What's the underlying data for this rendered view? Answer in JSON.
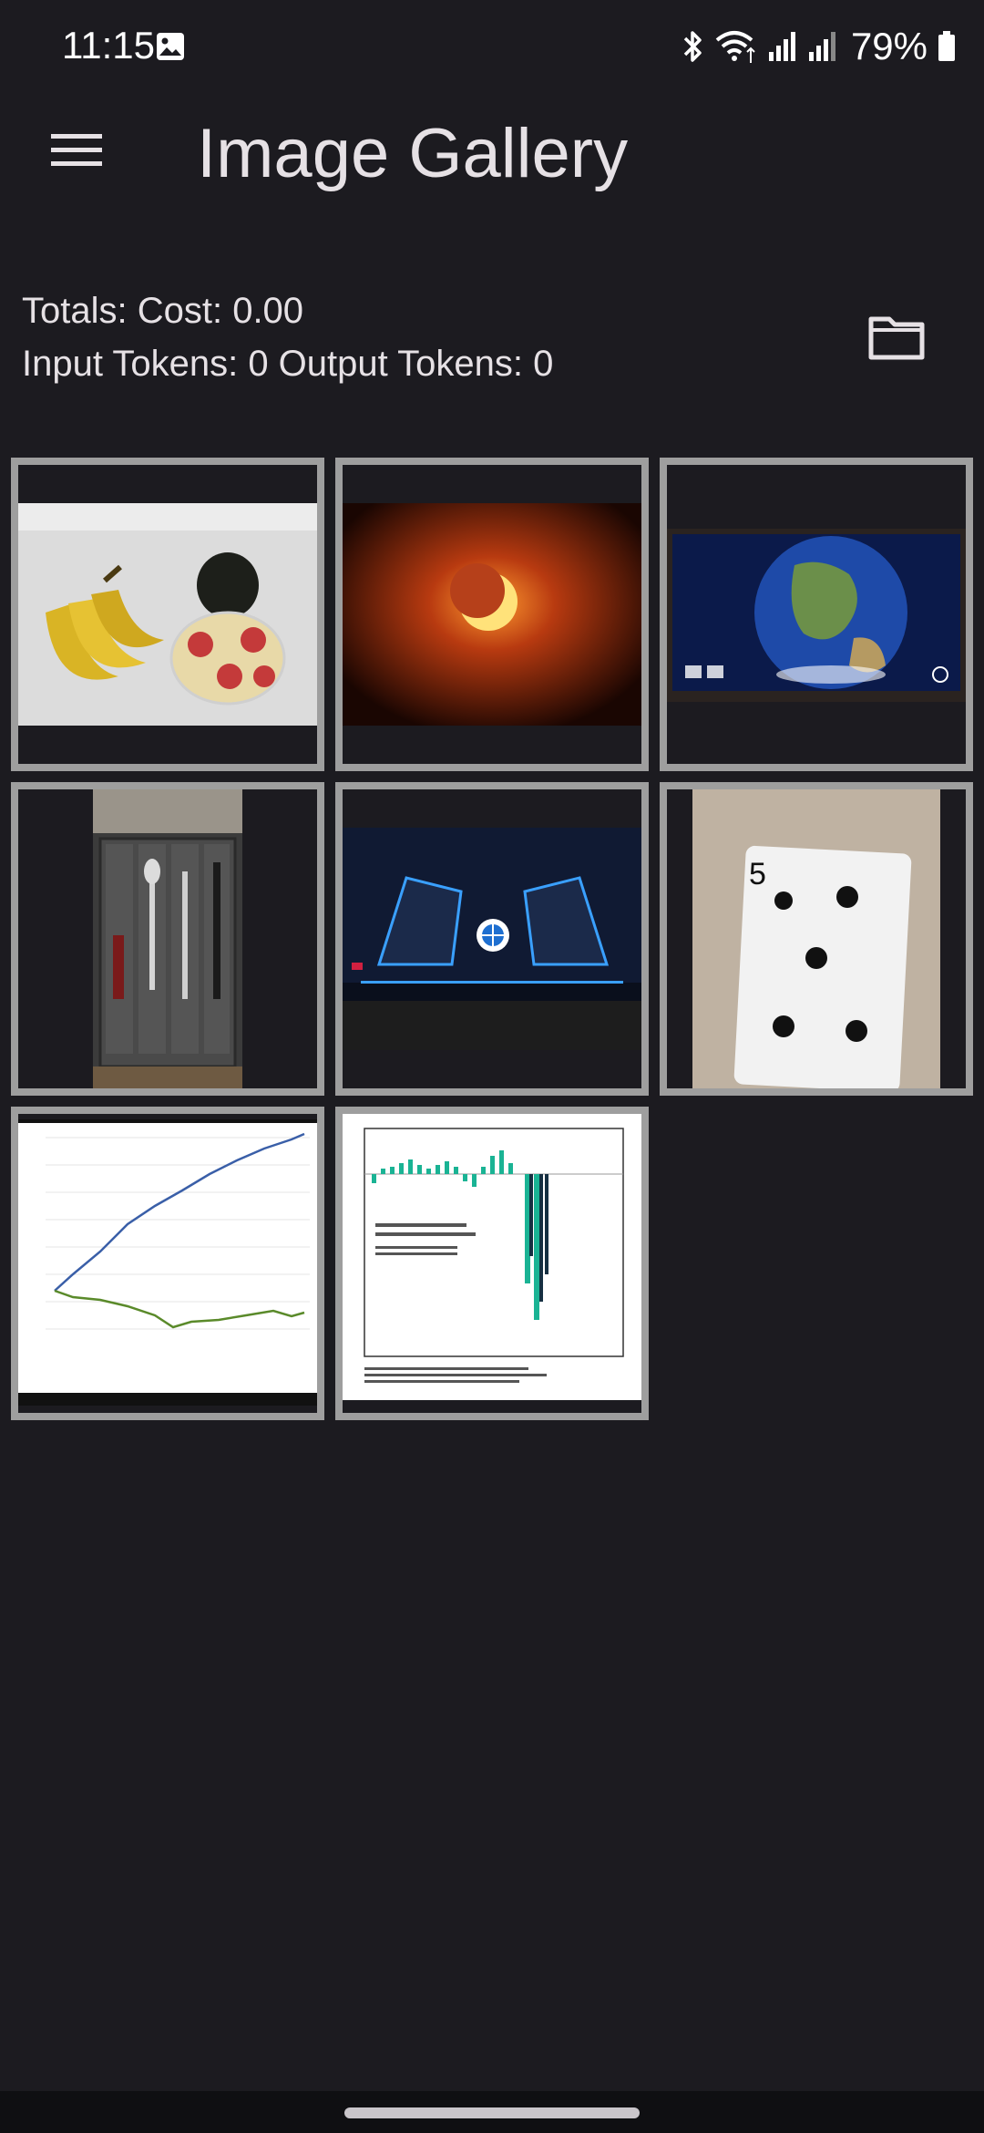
{
  "status_bar": {
    "time": "11:15",
    "battery": "79%",
    "icons": [
      "gallery-notification-icon",
      "bluetooth-icon",
      "wifi-icon",
      "signal-icon",
      "signal-icon",
      "battery-icon"
    ]
  },
  "app_bar": {
    "title": "Image Gallery",
    "menu_icon": "hamburger-menu-icon"
  },
  "totals": {
    "cost_line": "Totals: Cost: 0.00",
    "tokens_line": "Input Tokens: 0 Output Tokens: 0",
    "folder_icon": "folder-icon"
  },
  "gallery": {
    "images": [
      {
        "subject": "bananas, avocado and packaged cups"
      },
      {
        "subject": "partial solar eclipse"
      },
      {
        "subject": "globe on display screen"
      },
      {
        "subject": "cutlery drawer organizer"
      },
      {
        "subject": "car dashboard display"
      },
      {
        "subject": "five of clubs playing card"
      },
      {
        "subject": "line chart of nominal and real wages"
      },
      {
        "subject": "bar chart of unrealized gains/losses"
      }
    ]
  },
  "colors": {
    "background": "#1c1b20",
    "tile_border": "#9e9e9e",
    "text": "#e6e1e5"
  }
}
